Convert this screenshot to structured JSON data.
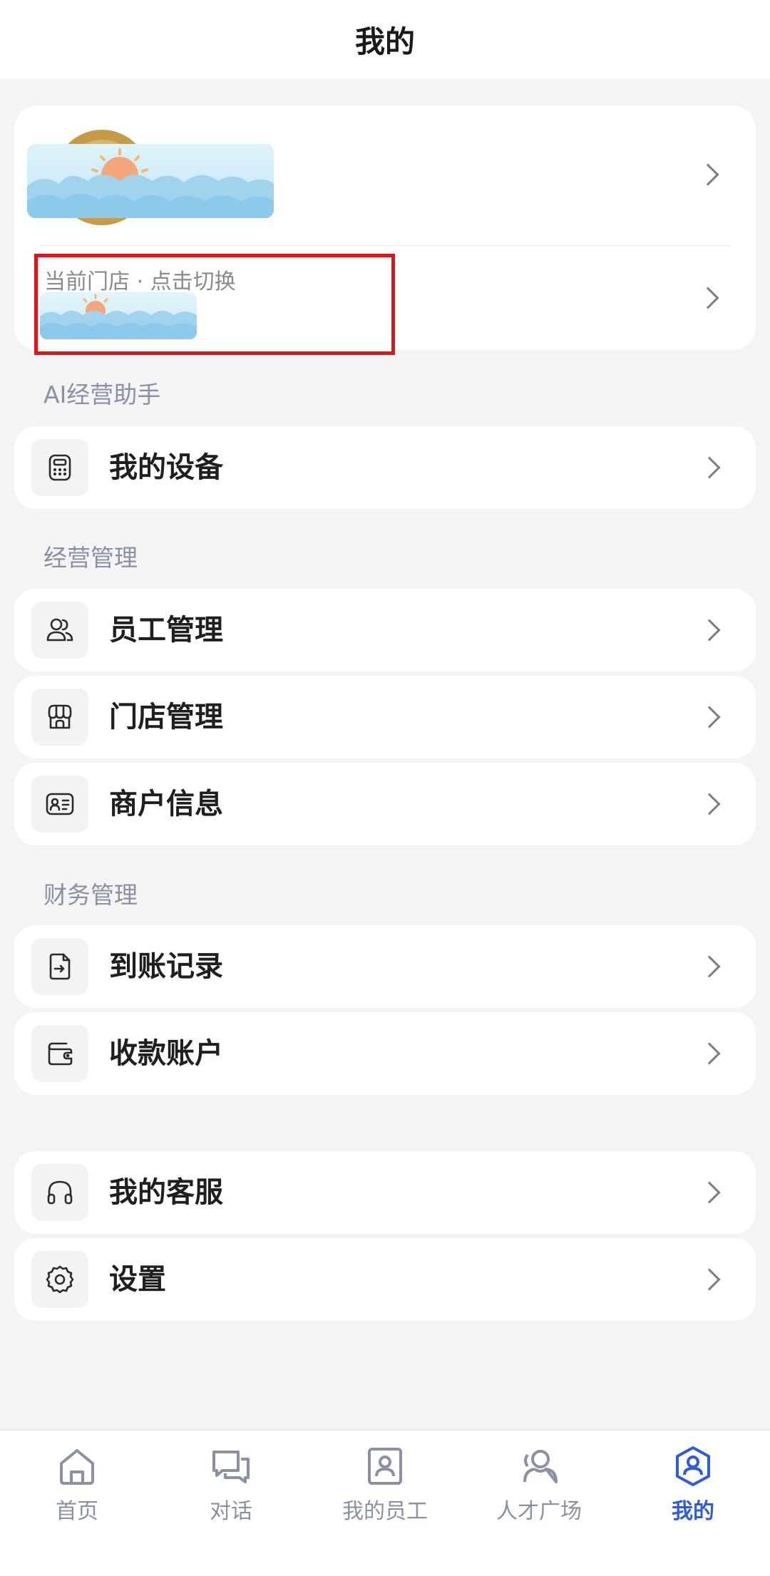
{
  "header": {
    "title": "我的"
  },
  "profile": {
    "store_caption": "当前门店 · 点击切换"
  },
  "sections": {
    "ai": "AI经营助手",
    "ops": "经营管理",
    "finance": "财务管理"
  },
  "rows": [
    {
      "label": "我的设备",
      "icon": "device-icon"
    },
    {
      "label": "员工管理",
      "icon": "staff-icon"
    },
    {
      "label": "门店管理",
      "icon": "store-icon"
    },
    {
      "label": "商户信息",
      "icon": "id-card-icon"
    },
    {
      "label": "到账记录",
      "icon": "receipt-icon"
    },
    {
      "label": "收款账户",
      "icon": "wallet-icon"
    },
    {
      "label": "我的客服",
      "icon": "headset-icon"
    },
    {
      "label": "设置",
      "icon": "gear-icon"
    }
  ],
  "nav": [
    {
      "label": "首页",
      "icon": "home-icon",
      "active": false
    },
    {
      "label": "对话",
      "icon": "chat-icon",
      "active": false
    },
    {
      "label": "我的员工",
      "icon": "employee-icon",
      "active": false
    },
    {
      "label": "人才广场",
      "icon": "talent-icon",
      "active": false
    },
    {
      "label": "我的",
      "icon": "profile-icon",
      "active": true
    }
  ],
  "colors": {
    "accent": "#2e5be0",
    "highlight": "#e0141b",
    "section_label": "#8b91a3",
    "background": "#f4f4f5"
  }
}
